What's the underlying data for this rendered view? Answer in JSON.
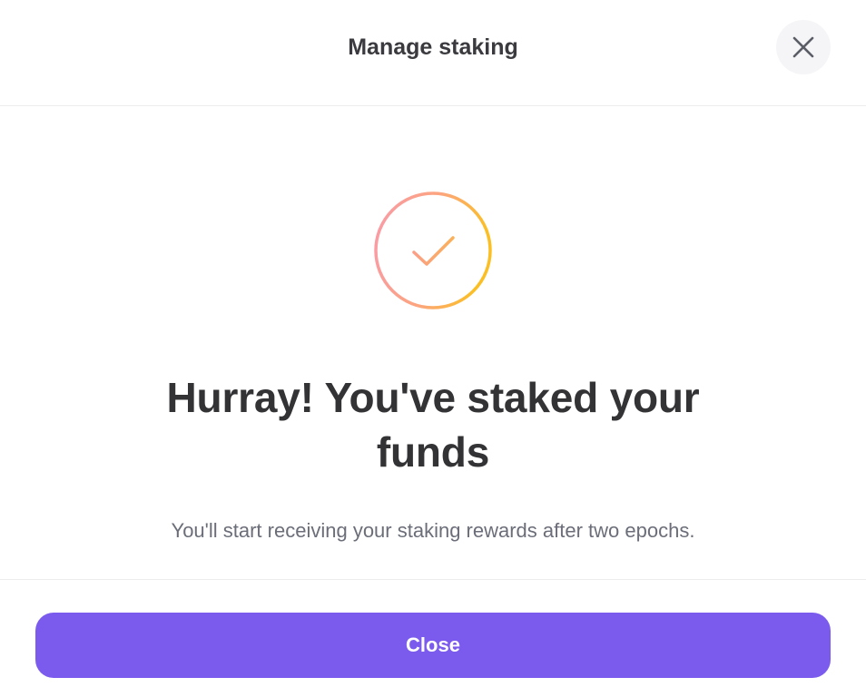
{
  "header": {
    "title": "Manage staking",
    "close_icon": "close-icon"
  },
  "success": {
    "icon": "checkmark-circle-icon",
    "gradient_colors": [
      "#f99aa9",
      "#fbbf24"
    ],
    "headline": "Hurray! You've staked your funds",
    "message": "You'll start receiving your staking rewards after two epochs."
  },
  "footer": {
    "close_label": "Close",
    "button_color": "#7b5bed"
  }
}
